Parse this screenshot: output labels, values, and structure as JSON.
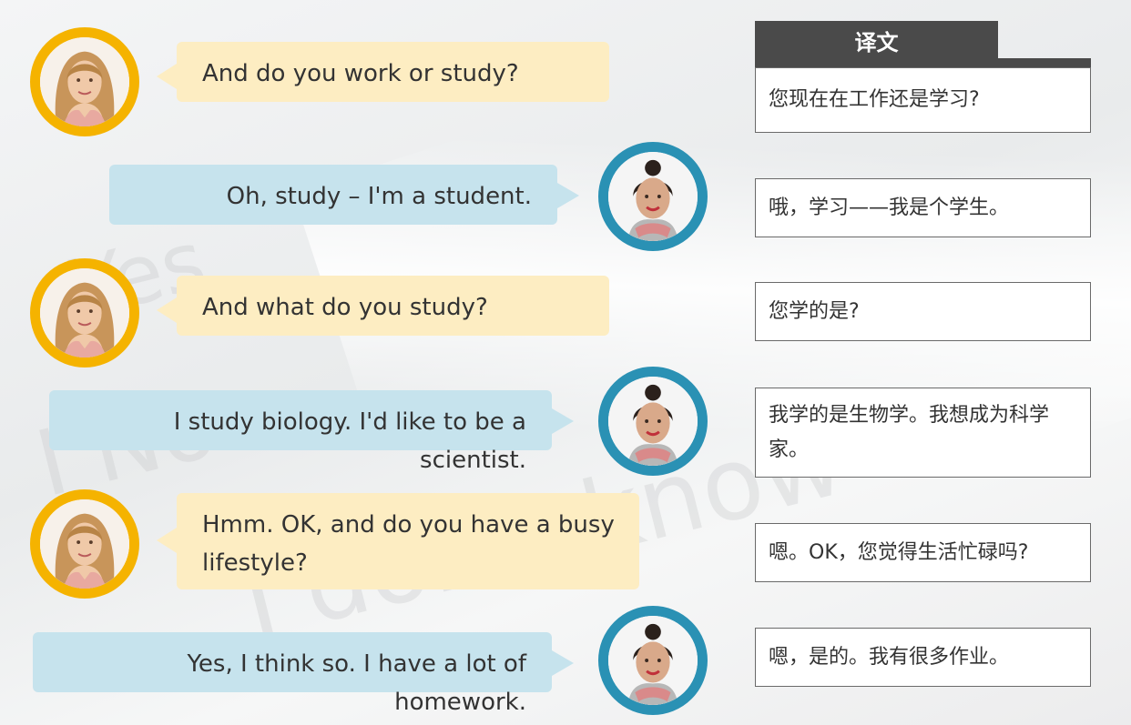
{
  "header": {
    "title": "译文"
  },
  "dialogue": [
    {
      "speaker": "blonde",
      "text": "And do you work or study?",
      "translation": "您现在在工作还是学习?"
    },
    {
      "speaker": "dark",
      "text": "Oh, study – I'm a student.",
      "translation": "哦，学习——我是个学生。"
    },
    {
      "speaker": "blonde",
      "text": "And what do you study?",
      "translation": "您学的是?"
    },
    {
      "speaker": "dark",
      "text": "I study biology. I'd like to be a scientist.",
      "translation": "我学的是生物学。我想成为科学家。"
    },
    {
      "speaker": "blonde",
      "text": "Hmm. OK, and do you have a busy lifestyle?",
      "translation": "嗯。OK，您觉得生活忙碌吗?"
    },
    {
      "speaker": "dark",
      "text": "Yes, I think so. I have a lot of homework.",
      "translation": "嗯，是的。我有很多作业。"
    }
  ],
  "colors": {
    "blonde_ring": "#f5b300",
    "dark_ring": "#2a91b4",
    "yellow_bubble": "#fdedc2",
    "blue_bubble": "#c6e3ed",
    "header_bg": "#4a4a4a"
  }
}
